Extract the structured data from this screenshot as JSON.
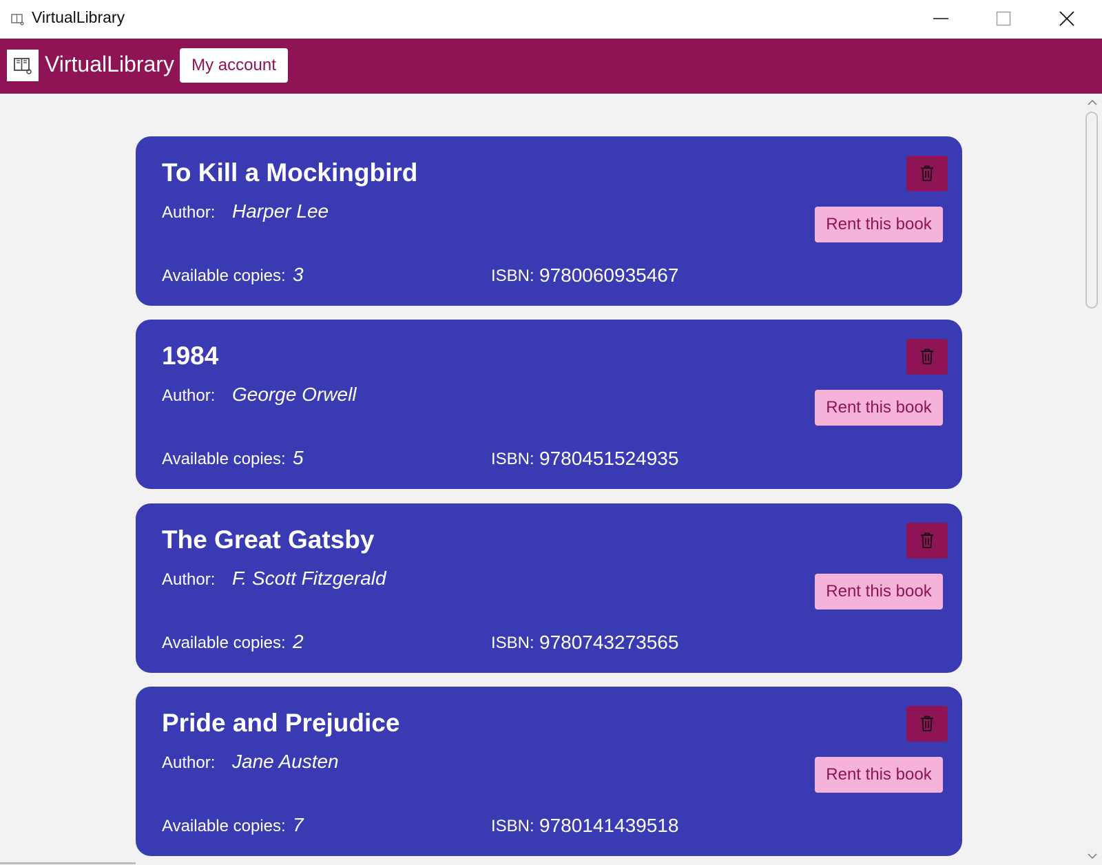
{
  "window": {
    "title": "VirtualLibrary"
  },
  "header": {
    "brand": "VirtualLibrary",
    "account_label": "My account"
  },
  "colors": {
    "header": "#8e1456",
    "card": "#3a3bb2",
    "rent_button": "#f6b3da",
    "delete_button": "#8e1456"
  },
  "labels": {
    "author": "Author:",
    "copies": "Available copies:",
    "isbn": "ISBN:",
    "rent": "Rent this book"
  },
  "books": [
    {
      "title": "To Kill a Mockingbird",
      "author": "Harper Lee",
      "copies": "3",
      "isbn": "9780060935467"
    },
    {
      "title": "1984",
      "author": "George Orwell",
      "copies": "5",
      "isbn": "9780451524935"
    },
    {
      "title": "The Great Gatsby",
      "author": "F. Scott Fitzgerald",
      "copies": "2",
      "isbn": "9780743273565"
    },
    {
      "title": "Pride and Prejudice",
      "author": "Jane Austen",
      "copies": "7",
      "isbn": "9780141439518"
    }
  ]
}
